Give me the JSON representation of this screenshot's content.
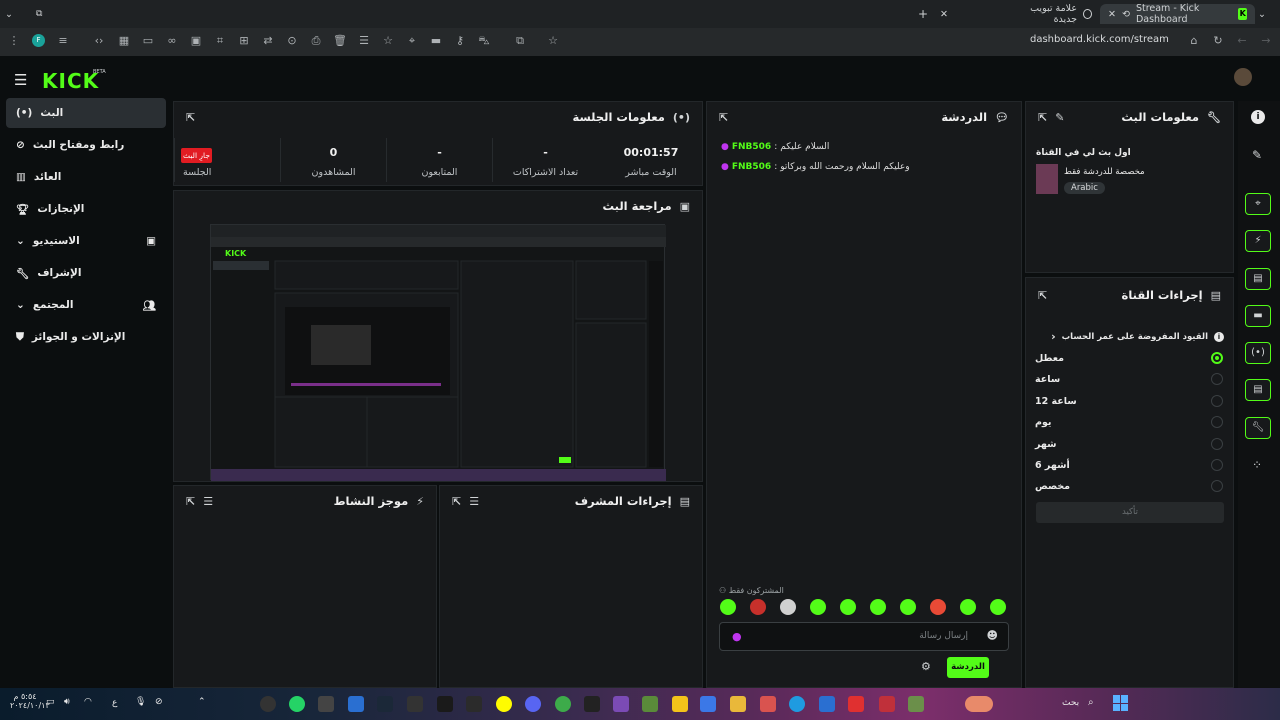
{
  "browser": {
    "tabs": [
      {
        "title": "Stream - Kick Dashboard"
      },
      {
        "title": "علامة تبويب جديدة"
      }
    ],
    "url": "dashboard.kick.com/stream"
  },
  "app": {
    "logo": "KICK",
    "beta": "BETA"
  },
  "nav": {
    "items": [
      {
        "label": "البث"
      },
      {
        "label": "رابط ومفتاح البث"
      },
      {
        "label": "العائد"
      },
      {
        "label": "الإنجازات"
      },
      {
        "label": "الاستيديو"
      },
      {
        "label": "الإشراف"
      },
      {
        "label": "المجتمع"
      },
      {
        "label": "الإنزالات و الجوائز"
      }
    ]
  },
  "session": {
    "title": "معلومات الجلسة",
    "live_badge": "جارِ البث",
    "stats": [
      {
        "value": "00:01:57",
        "label": "الوقت مباشر"
      },
      {
        "value": "-",
        "label": "تعداد الاشتراكات"
      },
      {
        "value": "-",
        "label": "المتابعون"
      },
      {
        "value": "0",
        "label": "المشاهدون"
      },
      {
        "value": "",
        "label": "الجلسة"
      }
    ]
  },
  "preview": {
    "title": "مراجعة البث"
  },
  "activity": {
    "title": "موجز النشاط"
  },
  "modactions": {
    "title": "إجراءات المشرف"
  },
  "chat": {
    "title": "الدردشة",
    "messages": [
      {
        "user": "FNB506",
        "text": "السلام عليكم"
      },
      {
        "user": "FNB506",
        "text": "وعليكم السلام ورحمت الله وبركاتو"
      }
    ],
    "subs_only": "المشتركون فقط",
    "placeholder": "إرسال رسالة",
    "send_label": "الدردشة"
  },
  "streaminfo": {
    "title": "معلومات البث",
    "stream_title": "اول بث لي في القناة",
    "category": "مخصصة للدردشة فقط",
    "language": "Arabic"
  },
  "channel_actions": {
    "title": "إجراءات القناة",
    "subtitle": "القيود المفروضة على عمر الحساب",
    "options": [
      {
        "label": "معطل",
        "selected": true
      },
      {
        "label": "ساعة",
        "selected": false
      },
      {
        "label": "12 ساعة",
        "selected": false
      },
      {
        "label": "يوم",
        "selected": false
      },
      {
        "label": "شهر",
        "selected": false
      },
      {
        "label": "6 أشهر",
        "selected": false
      },
      {
        "label": "مخصص",
        "selected": false
      }
    ],
    "confirm_label": "تأكيد"
  },
  "taskbar": {
    "search": "بحث",
    "time": "٥:٥٤ م",
    "date": "٢٠٢٤/١٠/١٣",
    "lang": "ع"
  },
  "colors": {
    "accent": "#53fc18",
    "live": "#e11c22",
    "panel": "#17191b"
  }
}
